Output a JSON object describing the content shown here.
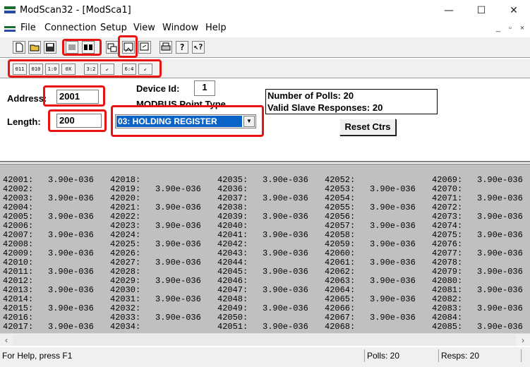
{
  "window": {
    "title": "ModScan32 - [ModSca1]",
    "minimize": "—",
    "maximize": "☐",
    "close": "✕"
  },
  "menu": {
    "items": [
      "File",
      "Connection",
      "Setup",
      "View",
      "Window",
      "Help"
    ],
    "mdi_minimize": "_",
    "mdi_restore": "▫",
    "mdi_close": "×"
  },
  "toolbar1": {
    "icons": [
      "new-file-icon",
      "open-folder-icon",
      "save-icon",
      "connect-icon",
      "disconnect-icon",
      "display-config-icon",
      "data-definition-icon",
      "poll-icon",
      "print-icon",
      "help-icon",
      "context-help-icon"
    ]
  },
  "toolbar2": {
    "labels": [
      "011",
      "010",
      "1:0",
      "0X",
      "3:2",
      "↙",
      "6:4",
      "↙"
    ]
  },
  "form": {
    "address_label": "Address:",
    "address_value": "2001",
    "length_label": "Length:",
    "length_value": "200",
    "device_id_label": "Device Id:",
    "device_id_value": "1",
    "point_type_label": "MODBUS Point Type",
    "point_type_value": "03: HOLDING REGISTER",
    "polls_line": "Number of Polls: 20",
    "responses_line": "Valid Slave Responses: 20",
    "reset_label": "Reset Ctrs"
  },
  "registers": {
    "value": "3.90e-036",
    "columns": [
      {
        "start": 42001,
        "values_on_odd": true
      },
      {
        "start": 42018,
        "values_on_odd": false
      },
      {
        "start": 42035,
        "values_on_odd": true
      },
      {
        "start": 42052,
        "values_on_odd": false
      },
      {
        "start": 42069,
        "values_on_odd": true
      }
    ],
    "rows_per_column": 17
  },
  "status": {
    "help": "For Help, press F1",
    "polls": "Polls: 20",
    "resps": "Resps: 20"
  },
  "colors": {
    "highlight_red": "#e81414",
    "selection_blue": "#0a64c8",
    "grid_gray": "#c0c0c0"
  }
}
